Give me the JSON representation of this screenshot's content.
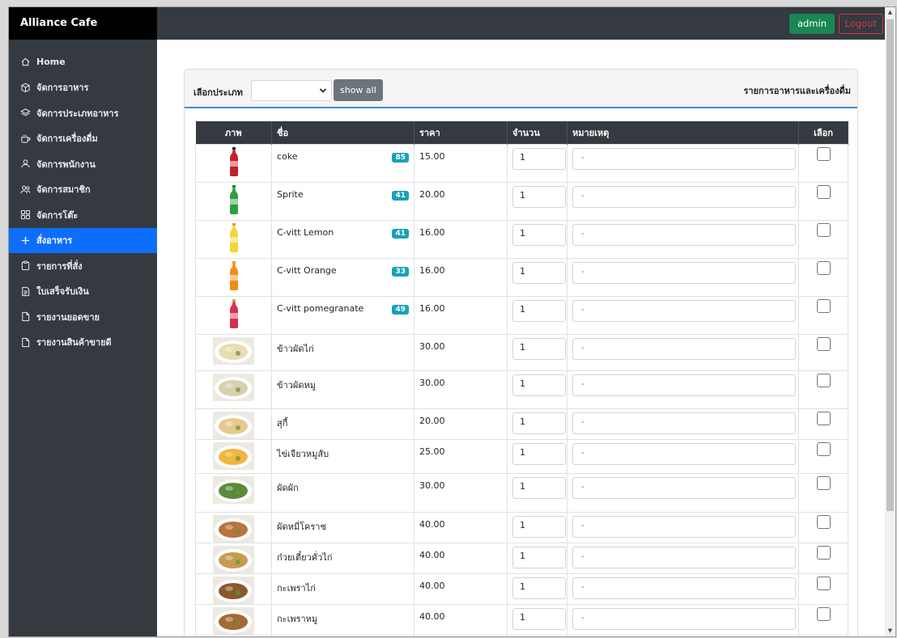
{
  "brand": "Alliance Cafe",
  "topbar": {
    "admin_label": "admin",
    "logout_label": "Logout"
  },
  "sidebar": {
    "items": [
      {
        "label": "Home",
        "icon": "home-icon"
      },
      {
        "label": "จัดการอาหาร",
        "icon": "box-icon"
      },
      {
        "label": "จัดการประเภทอาหาร",
        "icon": "layers-icon"
      },
      {
        "label": "จัดการเครื่องดื่ม",
        "icon": "cup-icon"
      },
      {
        "label": "จัดการพนักงาน",
        "icon": "person-icon"
      },
      {
        "label": "จัดการสมาชิก",
        "icon": "people-icon"
      },
      {
        "label": "จัดการโต๊ะ",
        "icon": "grid-icon"
      },
      {
        "label": "สั่งอาหาร",
        "icon": "plus-icon",
        "active": true
      },
      {
        "label": "รายการที่สั่ง",
        "icon": "clipboard-icon"
      },
      {
        "label": "ใบเสร็จรับเงิน",
        "icon": "receipt-icon"
      },
      {
        "label": "รายงานยอดขาย",
        "icon": "file-icon"
      },
      {
        "label": "รายงานสินค้าขายดี",
        "icon": "file-icon"
      }
    ]
  },
  "filter": {
    "label": "เลือกประเภท",
    "selected": "",
    "show_all_label": "show all"
  },
  "card_title": "รายการอาหารและเครื่องดื่ม",
  "table": {
    "headers": [
      "ภาพ",
      "ชื่อ",
      "ราคา",
      "จำนวน",
      "หมายเหตุ",
      "เลือก"
    ],
    "rows": [
      {
        "name": "coke",
        "badge": "85",
        "price": "15.00",
        "qty": "1",
        "note": "-",
        "kind": "bottle",
        "color": "#c0222a",
        "cap": "#222222"
      },
      {
        "name": "Sprite",
        "badge": "41",
        "price": "20.00",
        "qty": "1",
        "note": "-",
        "kind": "bottle",
        "color": "#2e9e3e",
        "cap": "#2a7a2f"
      },
      {
        "name": "C-vitt Lemon",
        "badge": "41",
        "price": "16.00",
        "qty": "1",
        "note": "-",
        "kind": "bottle",
        "color": "#f2d43b",
        "cap": "#e8a11b"
      },
      {
        "name": "C-vitt Orange",
        "badge": "33",
        "price": "16.00",
        "qty": "1",
        "note": "-",
        "kind": "bottle",
        "color": "#f08d1a",
        "cap": "#e8a11b"
      },
      {
        "name": "C-vitt pomegranate",
        "badge": "49",
        "price": "16.00",
        "qty": "1",
        "note": "-",
        "kind": "bottle",
        "color": "#d6304f",
        "cap": "#e8a11b"
      },
      {
        "name": "ข้าวผัดไก่",
        "badge": "",
        "price": "30.00",
        "qty": "1",
        "note": "-",
        "kind": "food",
        "color": "#e9dcb0"
      },
      {
        "name": "ข้าวผัดหมู",
        "badge": "",
        "price": "30.00",
        "qty": "1",
        "note": "-",
        "kind": "food",
        "color": "#d8cfae"
      },
      {
        "name": "สุกี้",
        "badge": "",
        "price": "20.00",
        "qty": "1",
        "note": "-",
        "kind": "food",
        "color": "#e7c98c"
      },
      {
        "name": "ไข่เจียวหมูสับ",
        "badge": "",
        "price": "25.00",
        "qty": "1",
        "note": "-",
        "kind": "food",
        "color": "#f1b63c"
      },
      {
        "name": "ผัดผัก",
        "badge": "",
        "price": "30.00",
        "qty": "1",
        "note": "-",
        "kind": "food",
        "color": "#5b8a3c"
      },
      {
        "name": "ผัดหมี่โคราช",
        "badge": "",
        "price": "40.00",
        "qty": "1",
        "note": "-",
        "kind": "food",
        "color": "#b8743c"
      },
      {
        "name": "ก๋วยเตี๋ยวคั่วไก่",
        "badge": "",
        "price": "40.00",
        "qty": "1",
        "note": "-",
        "kind": "food",
        "color": "#c79a52"
      },
      {
        "name": "กะเพราไก่",
        "badge": "",
        "price": "40.00",
        "qty": "1",
        "note": "-",
        "kind": "food",
        "color": "#8a5a2c"
      },
      {
        "name": "กะเพราหมู",
        "badge": "",
        "price": "40.00",
        "qty": "1",
        "note": "-",
        "kind": "food",
        "color": "#a36a35"
      },
      {
        "name": "",
        "badge": "",
        "price": "",
        "qty": "",
        "note": "",
        "kind": "food",
        "color": "#3a3a3a"
      }
    ]
  }
}
